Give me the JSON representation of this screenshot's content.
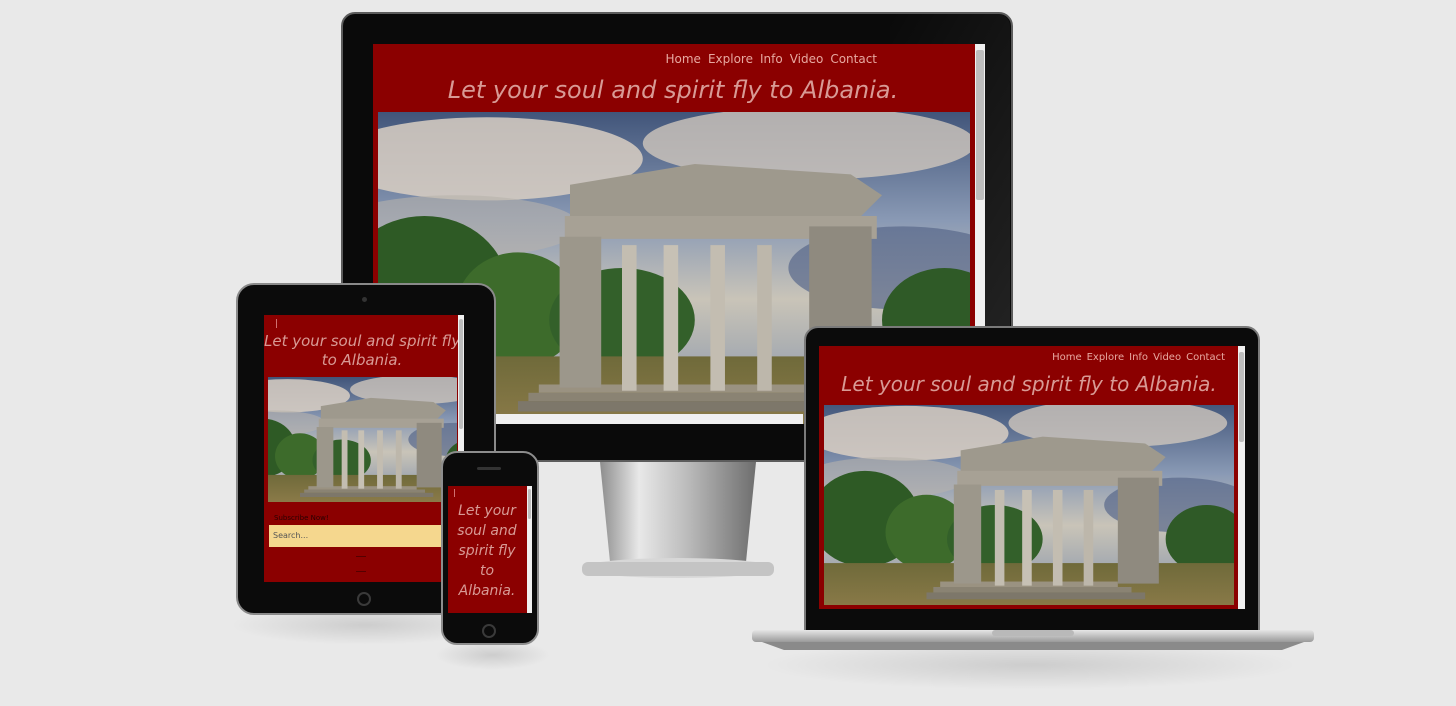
{
  "site": {
    "nav": [
      "Home",
      "Explore",
      "Info",
      "Video",
      "Contact"
    ],
    "slogan": "Let your soul and spirit fly to Albania.",
    "slogan_small": [
      "Let your",
      "soul and",
      "spirit fly",
      "to",
      "Albania."
    ],
    "tablet_slogan": [
      "Let your soul and spirit fly",
      "to Albania."
    ],
    "tablet_label": "Subscribe Now!",
    "search_placeholder": "Search..."
  },
  "colors": {
    "brand_red": "#8b0000",
    "nav_text": "#e7a8a0",
    "search_bg": "#f5d78e",
    "page_bg": "#e9e9e9"
  },
  "icons": [
    "home-button-icon",
    "camera-icon",
    "speaker-icon"
  ]
}
